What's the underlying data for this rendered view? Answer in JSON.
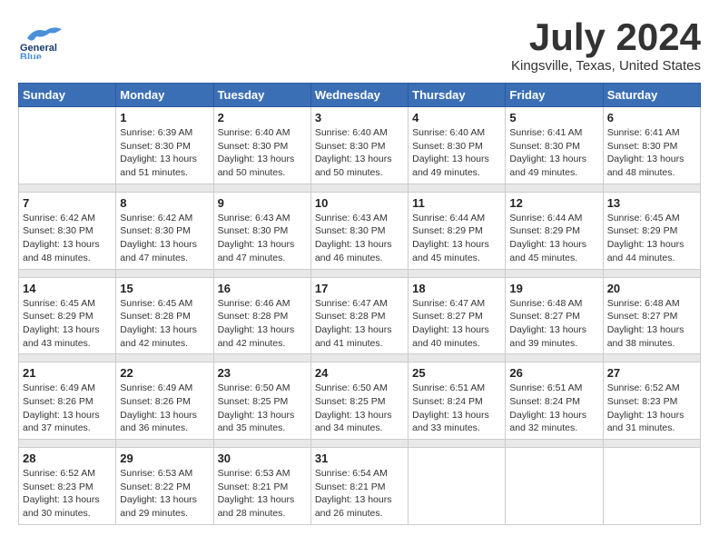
{
  "header": {
    "logo_general": "General",
    "logo_blue": "Blue",
    "month": "July 2024",
    "location": "Kingsville, Texas, United States"
  },
  "days_of_week": [
    "Sunday",
    "Monday",
    "Tuesday",
    "Wednesday",
    "Thursday",
    "Friday",
    "Saturday"
  ],
  "weeks": [
    [
      {
        "day": "",
        "sunrise": "",
        "sunset": "",
        "daylight": ""
      },
      {
        "day": "1",
        "sunrise": "Sunrise: 6:39 AM",
        "sunset": "Sunset: 8:30 PM",
        "daylight": "Daylight: 13 hours and 51 minutes."
      },
      {
        "day": "2",
        "sunrise": "Sunrise: 6:40 AM",
        "sunset": "Sunset: 8:30 PM",
        "daylight": "Daylight: 13 hours and 50 minutes."
      },
      {
        "day": "3",
        "sunrise": "Sunrise: 6:40 AM",
        "sunset": "Sunset: 8:30 PM",
        "daylight": "Daylight: 13 hours and 50 minutes."
      },
      {
        "day": "4",
        "sunrise": "Sunrise: 6:40 AM",
        "sunset": "Sunset: 8:30 PM",
        "daylight": "Daylight: 13 hours and 49 minutes."
      },
      {
        "day": "5",
        "sunrise": "Sunrise: 6:41 AM",
        "sunset": "Sunset: 8:30 PM",
        "daylight": "Daylight: 13 hours and 49 minutes."
      },
      {
        "day": "6",
        "sunrise": "Sunrise: 6:41 AM",
        "sunset": "Sunset: 8:30 PM",
        "daylight": "Daylight: 13 hours and 48 minutes."
      }
    ],
    [
      {
        "day": "7",
        "sunrise": "Sunrise: 6:42 AM",
        "sunset": "Sunset: 8:30 PM",
        "daylight": "Daylight: 13 hours and 48 minutes."
      },
      {
        "day": "8",
        "sunrise": "Sunrise: 6:42 AM",
        "sunset": "Sunset: 8:30 PM",
        "daylight": "Daylight: 13 hours and 47 minutes."
      },
      {
        "day": "9",
        "sunrise": "Sunrise: 6:43 AM",
        "sunset": "Sunset: 8:30 PM",
        "daylight": "Daylight: 13 hours and 47 minutes."
      },
      {
        "day": "10",
        "sunrise": "Sunrise: 6:43 AM",
        "sunset": "Sunset: 8:30 PM",
        "daylight": "Daylight: 13 hours and 46 minutes."
      },
      {
        "day": "11",
        "sunrise": "Sunrise: 6:44 AM",
        "sunset": "Sunset: 8:29 PM",
        "daylight": "Daylight: 13 hours and 45 minutes."
      },
      {
        "day": "12",
        "sunrise": "Sunrise: 6:44 AM",
        "sunset": "Sunset: 8:29 PM",
        "daylight": "Daylight: 13 hours and 45 minutes."
      },
      {
        "day": "13",
        "sunrise": "Sunrise: 6:45 AM",
        "sunset": "Sunset: 8:29 PM",
        "daylight": "Daylight: 13 hours and 44 minutes."
      }
    ],
    [
      {
        "day": "14",
        "sunrise": "Sunrise: 6:45 AM",
        "sunset": "Sunset: 8:29 PM",
        "daylight": "Daylight: 13 hours and 43 minutes."
      },
      {
        "day": "15",
        "sunrise": "Sunrise: 6:45 AM",
        "sunset": "Sunset: 8:28 PM",
        "daylight": "Daylight: 13 hours and 42 minutes."
      },
      {
        "day": "16",
        "sunrise": "Sunrise: 6:46 AM",
        "sunset": "Sunset: 8:28 PM",
        "daylight": "Daylight: 13 hours and 42 minutes."
      },
      {
        "day": "17",
        "sunrise": "Sunrise: 6:47 AM",
        "sunset": "Sunset: 8:28 PM",
        "daylight": "Daylight: 13 hours and 41 minutes."
      },
      {
        "day": "18",
        "sunrise": "Sunrise: 6:47 AM",
        "sunset": "Sunset: 8:27 PM",
        "daylight": "Daylight: 13 hours and 40 minutes."
      },
      {
        "day": "19",
        "sunrise": "Sunrise: 6:48 AM",
        "sunset": "Sunset: 8:27 PM",
        "daylight": "Daylight: 13 hours and 39 minutes."
      },
      {
        "day": "20",
        "sunrise": "Sunrise: 6:48 AM",
        "sunset": "Sunset: 8:27 PM",
        "daylight": "Daylight: 13 hours and 38 minutes."
      }
    ],
    [
      {
        "day": "21",
        "sunrise": "Sunrise: 6:49 AM",
        "sunset": "Sunset: 8:26 PM",
        "daylight": "Daylight: 13 hours and 37 minutes."
      },
      {
        "day": "22",
        "sunrise": "Sunrise: 6:49 AM",
        "sunset": "Sunset: 8:26 PM",
        "daylight": "Daylight: 13 hours and 36 minutes."
      },
      {
        "day": "23",
        "sunrise": "Sunrise: 6:50 AM",
        "sunset": "Sunset: 8:25 PM",
        "daylight": "Daylight: 13 hours and 35 minutes."
      },
      {
        "day": "24",
        "sunrise": "Sunrise: 6:50 AM",
        "sunset": "Sunset: 8:25 PM",
        "daylight": "Daylight: 13 hours and 34 minutes."
      },
      {
        "day": "25",
        "sunrise": "Sunrise: 6:51 AM",
        "sunset": "Sunset: 8:24 PM",
        "daylight": "Daylight: 13 hours and 33 minutes."
      },
      {
        "day": "26",
        "sunrise": "Sunrise: 6:51 AM",
        "sunset": "Sunset: 8:24 PM",
        "daylight": "Daylight: 13 hours and 32 minutes."
      },
      {
        "day": "27",
        "sunrise": "Sunrise: 6:52 AM",
        "sunset": "Sunset: 8:23 PM",
        "daylight": "Daylight: 13 hours and 31 minutes."
      }
    ],
    [
      {
        "day": "28",
        "sunrise": "Sunrise: 6:52 AM",
        "sunset": "Sunset: 8:23 PM",
        "daylight": "Daylight: 13 hours and 30 minutes."
      },
      {
        "day": "29",
        "sunrise": "Sunrise: 6:53 AM",
        "sunset": "Sunset: 8:22 PM",
        "daylight": "Daylight: 13 hours and 29 minutes."
      },
      {
        "day": "30",
        "sunrise": "Sunrise: 6:53 AM",
        "sunset": "Sunset: 8:21 PM",
        "daylight": "Daylight: 13 hours and 28 minutes."
      },
      {
        "day": "31",
        "sunrise": "Sunrise: 6:54 AM",
        "sunset": "Sunset: 8:21 PM",
        "daylight": "Daylight: 13 hours and 26 minutes."
      },
      {
        "day": "",
        "sunrise": "",
        "sunset": "",
        "daylight": ""
      },
      {
        "day": "",
        "sunrise": "",
        "sunset": "",
        "daylight": ""
      },
      {
        "day": "",
        "sunrise": "",
        "sunset": "",
        "daylight": ""
      }
    ]
  ]
}
